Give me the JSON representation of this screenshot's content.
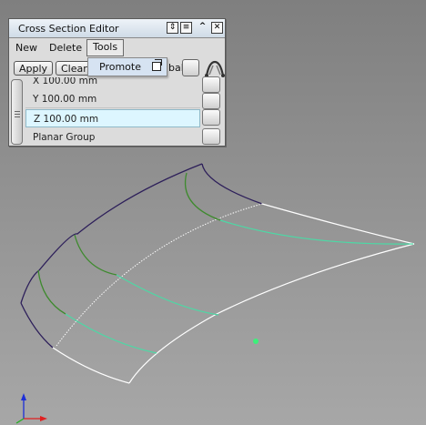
{
  "window": {
    "title": "Cross Section Editor",
    "title_buttons": [
      "⇕",
      "≡",
      "^",
      "✕"
    ]
  },
  "menu": {
    "items": [
      "New",
      "Delete",
      "Tools"
    ],
    "active": "Tools"
  },
  "toolbar": {
    "apply_label": "Apply",
    "clear_label": "Clear",
    "hidden_label_fragment": "bal"
  },
  "dropdown": {
    "items": [
      {
        "label": "Promote",
        "icon": "window-icon"
      }
    ]
  },
  "list": {
    "rows": [
      "X 100.00 mm",
      "Y 100.00 mm",
      "Z 100.00 mm",
      "Planar Group"
    ],
    "selected": "Z 100.00 mm"
  },
  "colors": {
    "curve_dark": "#2d1f5a",
    "curve_white": "#ffffff",
    "curve_green": "#3e8a2e",
    "curve_teal": "#4dd8a5",
    "axis_z": "#1d2fd8",
    "axis_x": "#e02020",
    "axis_y": "#20b020",
    "pivot": "#3cf07a"
  }
}
